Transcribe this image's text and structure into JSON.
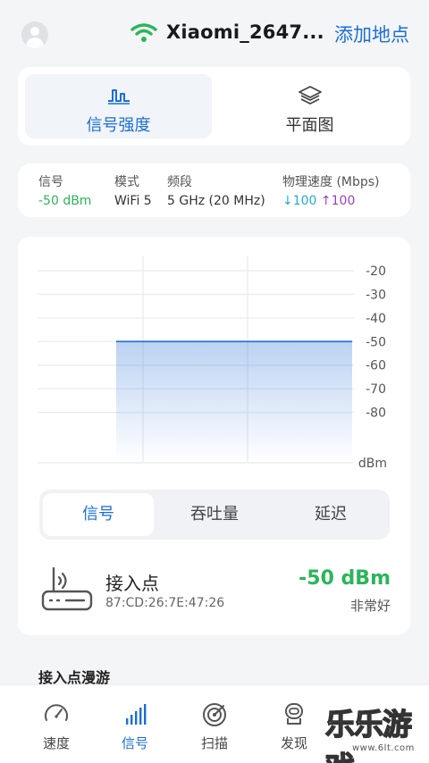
{
  "header": {
    "ssid": "Xiaomi_2647...",
    "add_place": "添加地点"
  },
  "view_tabs": [
    {
      "label": "信号强度",
      "icon": "signal-wave-icon",
      "active": true
    },
    {
      "label": "平面图",
      "icon": "layers-icon",
      "active": false
    }
  ],
  "info": {
    "signal": {
      "label": "信号",
      "value": "-50 dBm"
    },
    "mode": {
      "label": "模式",
      "value": "WiFi 5"
    },
    "band": {
      "label": "频段",
      "value": "5 GHz (20 MHz)"
    },
    "speed": {
      "label": "物理速度 (Mbps)",
      "down": "↓100",
      "up": "↑100"
    }
  },
  "chart_data": {
    "type": "area",
    "y_ticks": [
      "-20",
      "-30",
      "-40",
      "-50",
      "-60",
      "-70",
      "-80"
    ],
    "ylim": [
      -90,
      -20
    ],
    "unit_label": "dBm",
    "series": [
      {
        "values": [
          -50,
          -50
        ]
      }
    ],
    "grid": true,
    "color": "#2a72d6"
  },
  "metric_tabs": [
    {
      "label": "信号",
      "active": true
    },
    {
      "label": "吞吐量",
      "active": false
    },
    {
      "label": "延迟",
      "active": false
    }
  ],
  "access_point": {
    "title": "接入点",
    "mac": "87:CD:26:7E:47:26",
    "dbm": "-50 dBm",
    "quality": "非常好"
  },
  "roaming_title": "接入点漫游",
  "nav": [
    {
      "label": "速度",
      "icon": "speedometer-icon",
      "active": false
    },
    {
      "label": "信号",
      "icon": "signal-bars-icon",
      "active": true
    },
    {
      "label": "扫描",
      "icon": "radar-scan-icon",
      "active": false
    },
    {
      "label": "发现",
      "icon": "discover-robot-icon",
      "active": false
    }
  ],
  "watermark": {
    "text": "乐乐游戏",
    "url": "www.6lt.com"
  },
  "colors": {
    "accent": "#1a6ed8",
    "good": "#2bb55a",
    "down": "#25a9d8",
    "up": "#9b3fc7"
  }
}
